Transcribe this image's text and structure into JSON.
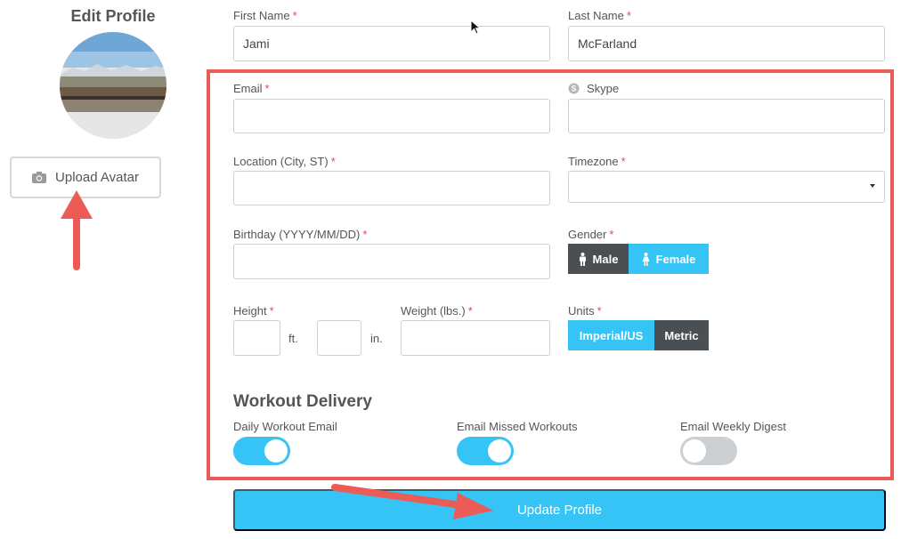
{
  "page": {
    "title": "Edit Profile"
  },
  "avatar": {
    "upload_label": "Upload Avatar"
  },
  "fields": {
    "first_name": {
      "label": "First Name",
      "value": "Jami"
    },
    "last_name": {
      "label": "Last Name",
      "value": "McFarland"
    },
    "email": {
      "label": "Email",
      "value": ""
    },
    "skype": {
      "label": "Skype",
      "value": ""
    },
    "location": {
      "label": "Location (City, ST)",
      "value": ""
    },
    "timezone": {
      "label": "Timezone",
      "value": ""
    },
    "birthday": {
      "label": "Birthday (YYYY/MM/DD)",
      "value": ""
    },
    "height": {
      "label": "Height",
      "ft_unit": "ft.",
      "in_unit": "in."
    },
    "weight": {
      "label": "Weight (lbs.)",
      "value": ""
    }
  },
  "gender": {
    "label": "Gender",
    "options": [
      "Male",
      "Female"
    ],
    "selected": "Female"
  },
  "units": {
    "label": "Units",
    "options": [
      "Imperial/US",
      "Metric"
    ],
    "selected": "Imperial/US"
  },
  "workout_delivery": {
    "title": "Workout Delivery",
    "toggles": [
      {
        "label": "Daily Workout Email",
        "on": true
      },
      {
        "label": "Email Missed Workouts",
        "on": true
      },
      {
        "label": "Email Weekly Digest",
        "on": false
      }
    ]
  },
  "actions": {
    "update_label": "Update Profile"
  },
  "colors": {
    "accent": "#36c3f5",
    "dark": "#4a4f54",
    "highlight": "#ec5b55",
    "required": "#e24b50"
  }
}
